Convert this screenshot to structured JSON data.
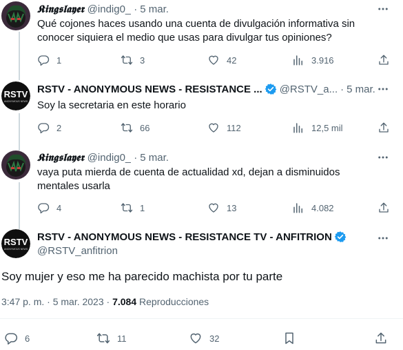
{
  "colors": {
    "accent": "#1d9bf0",
    "secondary_text": "#536471",
    "divider": "#eff3f4",
    "thread_line": "#cfd9de"
  },
  "tweets": [
    {
      "display_name": "𝕶𝖎𝖓𝖌𝖘𝖑𝖆𝖞𝖊𝖗",
      "handle": "@indig0_",
      "dot": "·",
      "time": "5 mar.",
      "text": "Qué cojones haces usando una cuenta de divulgación informativa sin conocer siquiera el medio que usas para divulgar tus opiniones?",
      "replies": "1",
      "retweets": "3",
      "likes": "42",
      "views": "3.916"
    },
    {
      "display_name": "RSTV - ANONYMOUS NEWS - RESISTANCE ...",
      "handle": "@RSTV_a...",
      "dot": "·",
      "time": "5 mar.",
      "text": "Soy la secretaria en este horario",
      "replies": "2",
      "retweets": "66",
      "likes": "112",
      "views": "12,5 mil"
    },
    {
      "display_name": "𝕶𝖎𝖓𝖌𝖘𝖑𝖆𝖞𝖊𝖗",
      "handle": "@indig0_",
      "dot": "·",
      "time": "5 mar.",
      "text": "vaya puta mierda de cuenta de actualidad xd, dejan a disminuidos mentales usarla",
      "replies": "4",
      "retweets": "1",
      "likes": "13",
      "views": "4.082"
    }
  ],
  "main_tweet": {
    "display_name": "RSTV - ANONYMOUS NEWS - RESISTANCE TV - ANFITRION",
    "handle": "@RSTV_anfitrion",
    "text": "Soy mujer y eso me ha parecido machista por tu parte",
    "timestamp": "3:47 p. m. · 5 mar. 2023 · ",
    "views_count": "7.084",
    "views_label": " Reproducciones",
    "replies": "6",
    "retweets": "11",
    "likes": "32"
  },
  "avatar_text": {
    "line1": "RSTV",
    "line2": "ANONYMOUS NEWS"
  }
}
